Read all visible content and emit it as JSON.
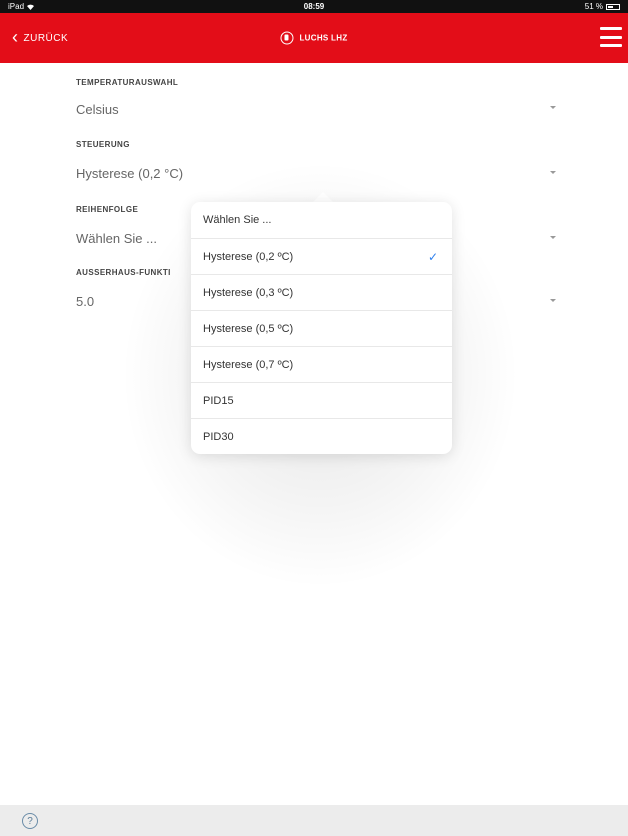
{
  "status_bar": {
    "carrier": "iPad",
    "time": "08:59",
    "battery": "51 %"
  },
  "nav": {
    "back_label": "ZURÜCK",
    "logo_text": "LUCHS LHZ",
    "accent_color": "#e30d18"
  },
  "form": {
    "temperature": {
      "label": "TEMPERATURAUSWAHL",
      "value": "Celsius"
    },
    "control": {
      "label": "STEUERUNG",
      "value": "Hysterese (0,2 °C)"
    },
    "order": {
      "label": "REIHENFOLGE",
      "value": "Wählen Sie ..."
    },
    "away": {
      "label": "AUSSERHAUS-FUNKTI",
      "value": "5.0"
    }
  },
  "popover": {
    "options": [
      {
        "label": "Wählen Sie ...",
        "selected": false
      },
      {
        "label": "Hysterese (0,2 ºC)",
        "selected": true
      },
      {
        "label": "Hysterese (0,3 ºC)",
        "selected": false
      },
      {
        "label": "Hysterese (0,5 ºC)",
        "selected": false
      },
      {
        "label": "Hysterese (0,7 ºC)",
        "selected": false
      },
      {
        "label": "PID15",
        "selected": false
      },
      {
        "label": "PID30",
        "selected": false
      }
    ],
    "check_icon": "checkmark-icon"
  },
  "bottom_bar": {
    "help_icon": "help-icon",
    "help_glyph": "?"
  }
}
